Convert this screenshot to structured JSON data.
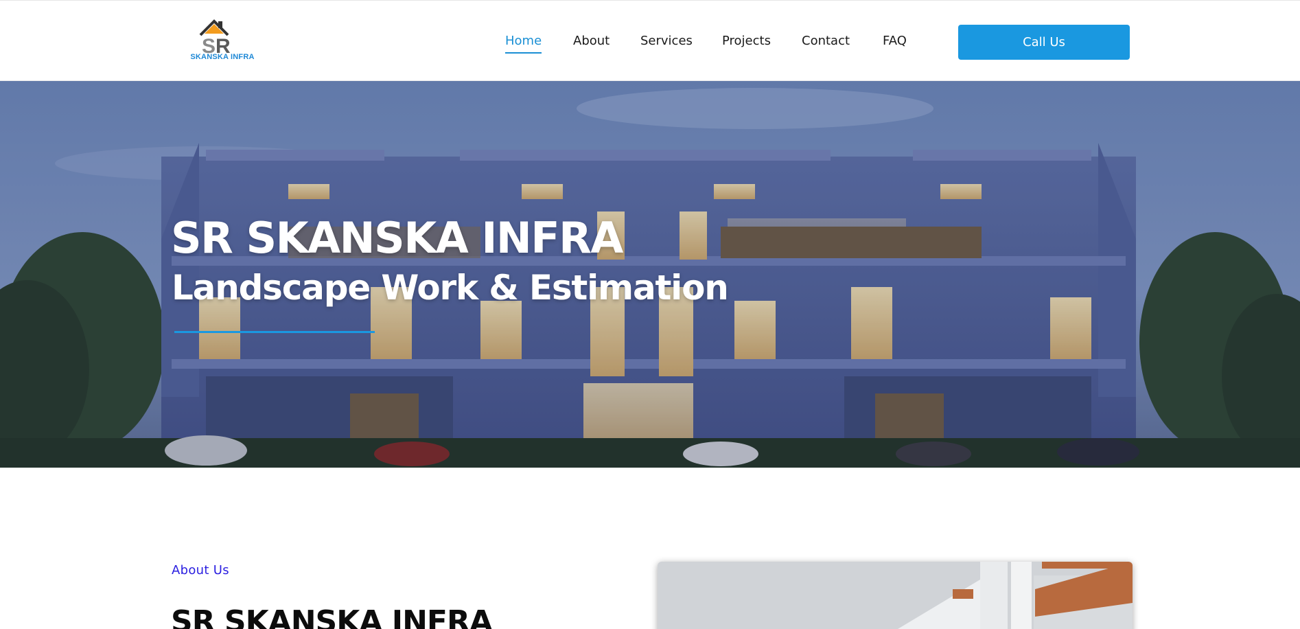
{
  "brand": {
    "logo_text": "SKANSKA INFRA",
    "logo_mark": "SR",
    "accent_color": "#1a98e0"
  },
  "nav": {
    "items": [
      {
        "label": "Home",
        "active": true
      },
      {
        "label": "About",
        "active": false
      },
      {
        "label": "Services",
        "active": false
      },
      {
        "label": "Projects",
        "active": false
      },
      {
        "label": "Contact",
        "active": false
      },
      {
        "label": "FAQ",
        "active": false
      }
    ],
    "cta_label": "Call Us"
  },
  "hero": {
    "title": "SR SKANSKA INFRA",
    "subtitle": "Landscape Work & Estimation",
    "background": "residential-building-dusk-photo"
  },
  "about": {
    "label": "About Us",
    "heading": "SR SKANSKA INFRA",
    "label_color": "#2a1ee0",
    "image": "building-facade-photo"
  }
}
